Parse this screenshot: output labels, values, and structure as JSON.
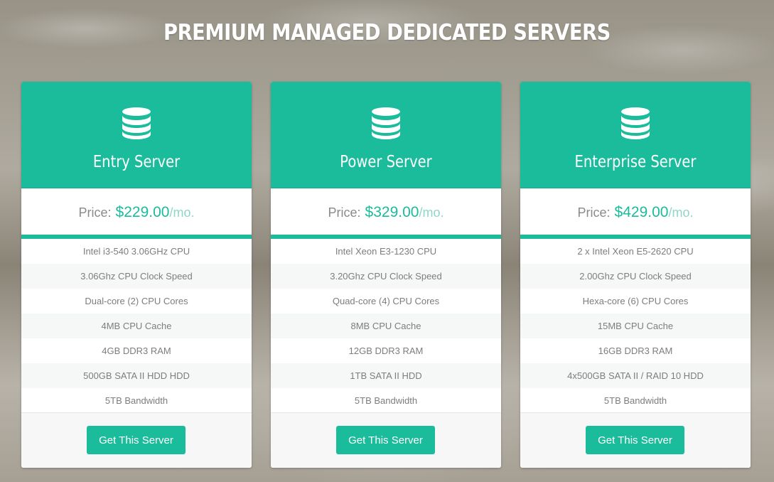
{
  "page": {
    "title": "PREMIUM MANAGED DEDICATED SERVERS"
  },
  "colors": {
    "accent": "#1abc9c",
    "feature_text": "#7d7d7d",
    "price_label": "#8a8a8a"
  },
  "plans": [
    {
      "icon": "database-icon",
      "name": "Entry Server",
      "price_label": "Price:",
      "price": "$229.00",
      "period": "/mo.",
      "features": [
        "Intel i3-540 3.06GHz CPU",
        "3.06Ghz CPU Clock Speed",
        "Dual-core (2) CPU Cores",
        "4MB CPU Cache",
        "4GB DDR3 RAM",
        "500GB SATA II HDD HDD",
        "5TB Bandwidth"
      ],
      "button_label": "Get This Server"
    },
    {
      "icon": "database-icon",
      "name": "Power Server",
      "price_label": "Price:",
      "price": "$329.00",
      "period": "/mo.",
      "features": [
        "Intel Xeon E3-1230 CPU",
        "3.20Ghz CPU Clock Speed",
        "Quad-core (4) CPU Cores",
        "8MB CPU Cache",
        "12GB DDR3 RAM",
        "1TB SATA II HDD",
        "5TB Bandwidth"
      ],
      "button_label": "Get This Server"
    },
    {
      "icon": "database-icon",
      "name": "Enterprise Server",
      "price_label": "Price:",
      "price": "$429.00",
      "period": "/mo.",
      "features": [
        "2 x Intel Xeon E5-2620 CPU",
        "2.00Ghz CPU Clock Speed",
        "Hexa-core (6) CPU Cores",
        "15MB CPU Cache",
        "16GB DDR3 RAM",
        "4x500GB SATA II / RAID 10 HDD",
        "5TB Bandwidth"
      ],
      "button_label": "Get This Server"
    }
  ]
}
